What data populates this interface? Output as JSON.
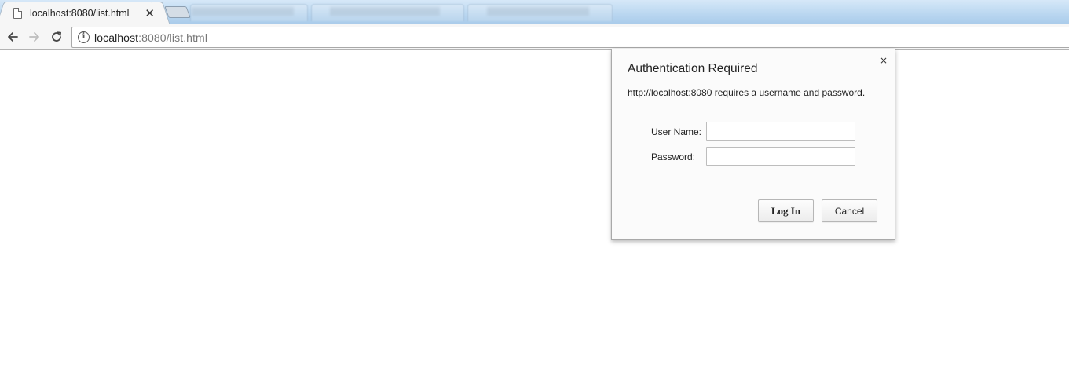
{
  "browser": {
    "active_tab": {
      "title": "localhost:8080/list.html",
      "icon": "page-icon"
    },
    "address_bar": {
      "host": "localhost",
      "rest": ":8080/list.html"
    }
  },
  "dialog": {
    "title": "Authentication Required",
    "message": "http://localhost:8080 requires a username and password.",
    "close_label": "×",
    "username": {
      "label": "User Name:",
      "value": "",
      "placeholder": ""
    },
    "password": {
      "label": "Password:",
      "value": "",
      "placeholder": ""
    },
    "login_label": "Log In",
    "cancel_label": "Cancel"
  }
}
